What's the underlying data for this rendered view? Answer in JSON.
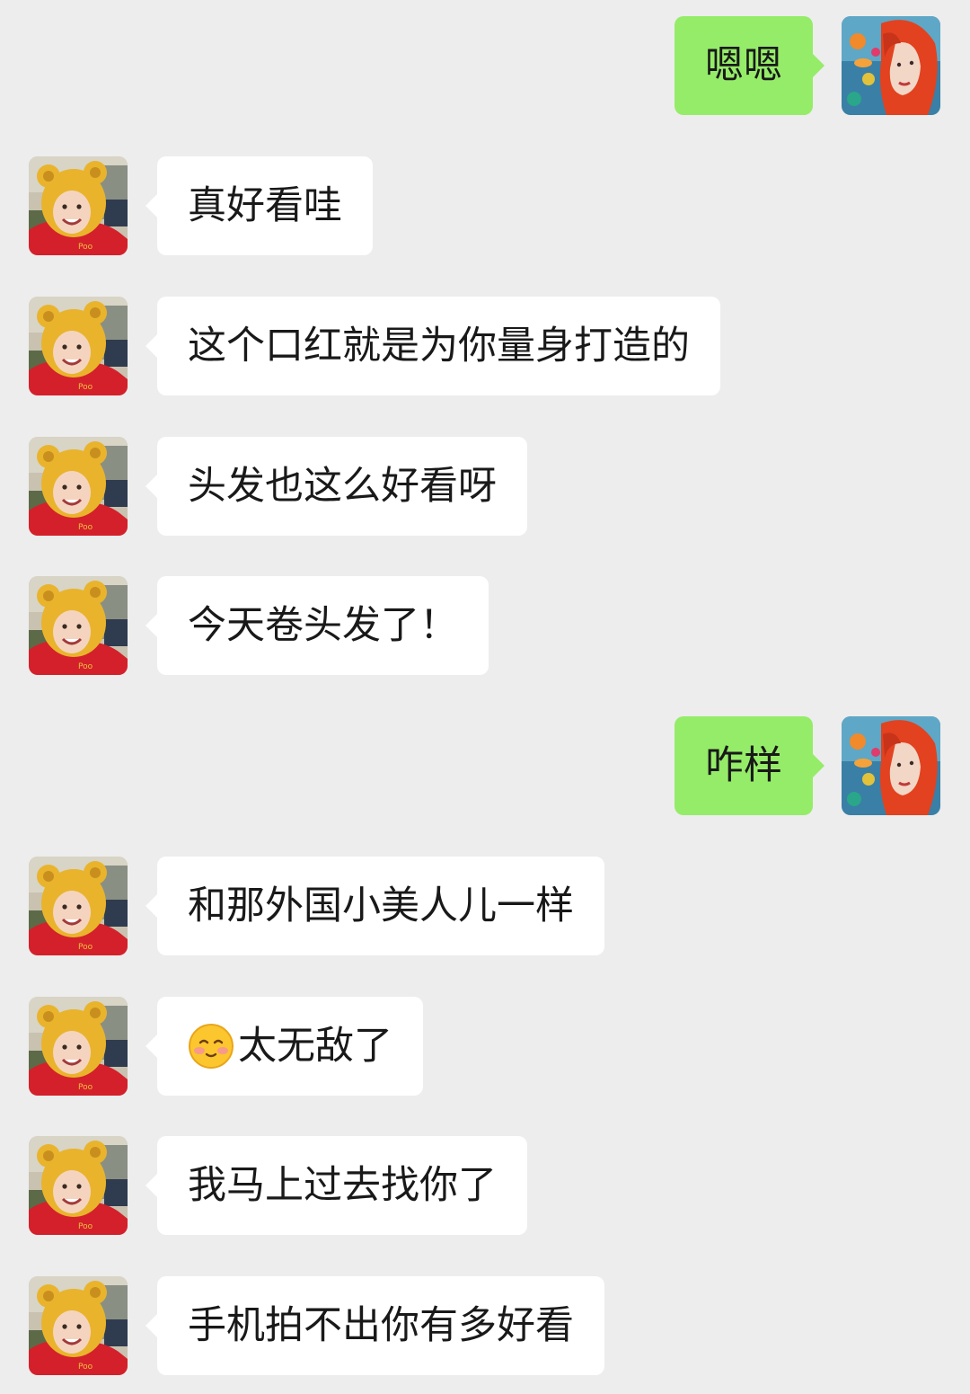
{
  "colors": {
    "background": "#ededed",
    "incoming_bubble": "#ffffff",
    "outgoing_bubble": "#95ec69",
    "text": "#191919"
  },
  "messages": [
    {
      "side": "right",
      "avatar": "red-haired-girl-avatar",
      "text": "嗯嗯"
    },
    {
      "side": "left",
      "avatar": "child-in-bear-costume-avatar",
      "text": "真好看哇"
    },
    {
      "side": "left",
      "avatar": "child-in-bear-costume-avatar",
      "text": "这个口红就是为你量身打造的"
    },
    {
      "side": "left",
      "avatar": "child-in-bear-costume-avatar",
      "text": "头发也这么好看呀"
    },
    {
      "side": "left",
      "avatar": "child-in-bear-costume-avatar",
      "text": "今天卷头发了！"
    },
    {
      "side": "right",
      "avatar": "red-haired-girl-avatar",
      "text": "咋样"
    },
    {
      "side": "left",
      "avatar": "child-in-bear-costume-avatar",
      "text": "和那外国小美人儿一样"
    },
    {
      "side": "left",
      "avatar": "child-in-bear-costume-avatar",
      "emoji": "blushing-face-emoji",
      "text": "太无敌了"
    },
    {
      "side": "left",
      "avatar": "child-in-bear-costume-avatar",
      "text": "我马上过去找你了"
    },
    {
      "side": "left",
      "avatar": "child-in-bear-costume-avatar",
      "text": "手机拍不出你有多好看"
    }
  ]
}
